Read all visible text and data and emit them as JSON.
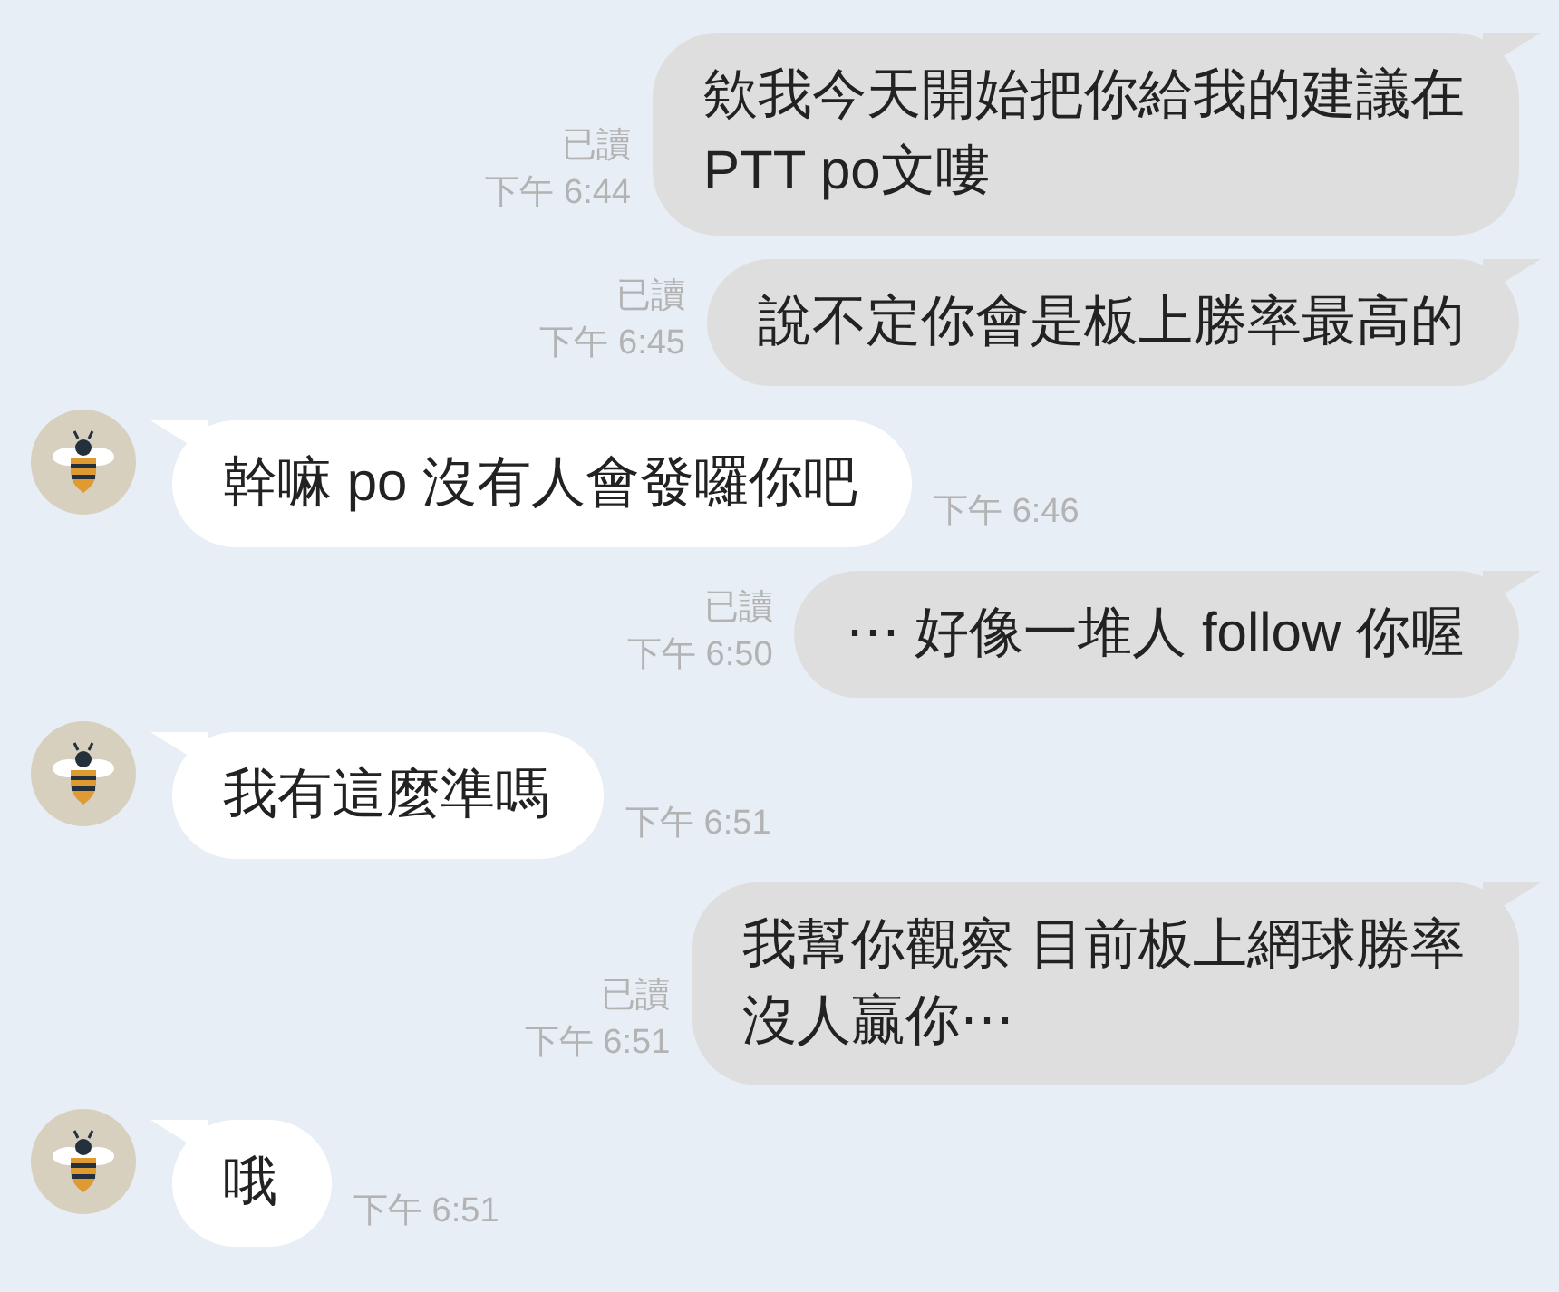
{
  "messages": [
    {
      "kind": "sent",
      "lines": [
        "欸我今天開始把你給我的建議在",
        "PTT po文嘍"
      ],
      "read": "已讀",
      "time": "下午 6:44"
    },
    {
      "kind": "sent",
      "lines": [
        "說不定你會是板上勝率最高的"
      ],
      "read": "已讀",
      "time": "下午 6:45"
    },
    {
      "kind": "received",
      "lines": [
        "幹嘛 po 沒有人會發囉你吧"
      ],
      "time": "下午 6:46"
    },
    {
      "kind": "sent",
      "lines": [
        "⋯ 好像一堆人 follow 你喔"
      ],
      "read": "已讀",
      "time": "下午 6:50"
    },
    {
      "kind": "received",
      "lines": [
        "我有這麼準嗎"
      ],
      "time": "下午 6:51"
    },
    {
      "kind": "sent",
      "lines": [
        "我幫你觀察 目前板上網球勝率",
        "沒人贏你⋯"
      ],
      "read": "已讀",
      "time": "下午 6:51"
    },
    {
      "kind": "received",
      "lines": [
        "哦"
      ],
      "time": "下午 6:51"
    }
  ]
}
